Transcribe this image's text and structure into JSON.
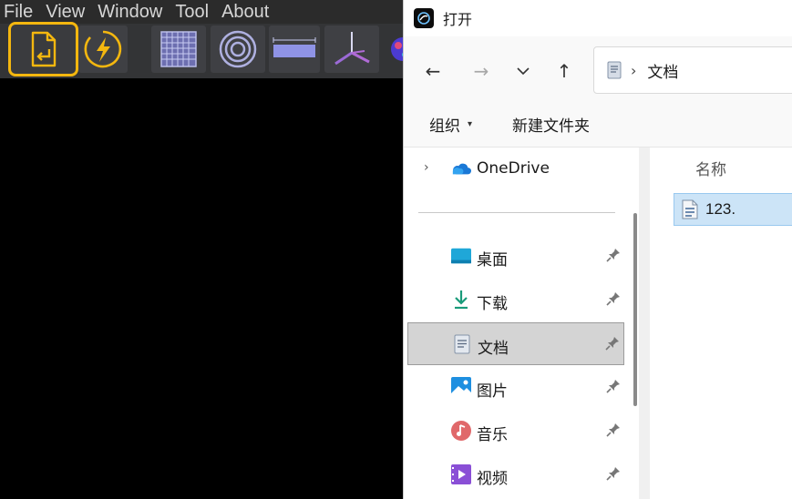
{
  "app": {
    "menu": [
      "File",
      "View",
      "Window",
      "Tool",
      "About"
    ],
    "accent_color": "#f4b70f"
  },
  "dialog": {
    "title": "打开",
    "nav": {
      "back": "←",
      "forward": "→",
      "recent": "⌄",
      "up": "↑"
    },
    "address": {
      "separator": "›",
      "location": "文档"
    },
    "commands": {
      "organize": "组织",
      "organize_caret": "▾",
      "new_folder": "新建文件夹"
    },
    "sidebar": {
      "onedrive": "OneDrive",
      "expand": "›",
      "items": [
        {
          "label": "桌面",
          "icon": "desktop-icon"
        },
        {
          "label": "下载",
          "icon": "download-icon"
        },
        {
          "label": "文档",
          "icon": "documents-icon"
        },
        {
          "label": "图片",
          "icon": "pictures-icon"
        },
        {
          "label": "音乐",
          "icon": "music-icon"
        },
        {
          "label": "视频",
          "icon": "videos-icon"
        }
      ]
    },
    "content": {
      "column_name": "名称",
      "files": [
        {
          "name": "123."
        }
      ]
    }
  }
}
